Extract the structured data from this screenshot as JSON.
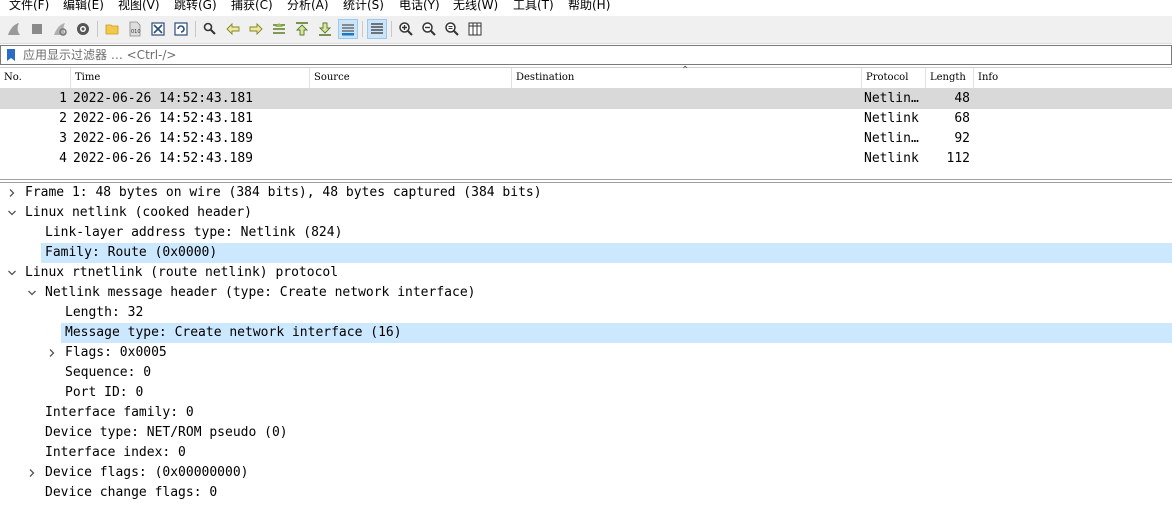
{
  "menu": [
    "文件(F)",
    "编辑(E)",
    "视图(V)",
    "跳转(G)",
    "捕获(C)",
    "分析(A)",
    "统计(S)",
    "电话(Y)",
    "无线(W)",
    "工具(T)",
    "帮助(H)"
  ],
  "toolbar": {
    "icons": [
      "shark-fin-start-icon",
      "stop-icon",
      "restart-icon",
      "options-gear-icon",
      "open-folder-icon",
      "save-file-icon",
      "close-file-icon",
      "reload-icon",
      "find-icon",
      "go-back-icon",
      "go-forward-icon",
      "go-to-packet-icon",
      "first-packet-icon",
      "last-packet-icon",
      "autoscroll-icon",
      "colorize-icon",
      "zoom-in-icon",
      "zoom-out-icon",
      "zoom-normal-icon",
      "resize-columns-icon"
    ]
  },
  "filter": {
    "placeholder": "应用显示过滤器 … <Ctrl-/>"
  },
  "packet_list": {
    "columns": [
      "No.",
      "Time",
      "Source",
      "Destination",
      "Protocol",
      "Length",
      "Info"
    ],
    "rows": [
      {
        "no": "1",
        "time": "2022-06-26 14:52:43.181",
        "source": "",
        "destination": "",
        "protocol": "Netlin…",
        "length": "48",
        "info": ""
      },
      {
        "no": "2",
        "time": "2022-06-26 14:52:43.181",
        "source": "",
        "destination": "",
        "protocol": "Netlink",
        "length": "68",
        "info": ""
      },
      {
        "no": "3",
        "time": "2022-06-26 14:52:43.189",
        "source": "",
        "destination": "",
        "protocol": "Netlin…",
        "length": "92",
        "info": ""
      },
      {
        "no": "4",
        "time": "2022-06-26 14:52:43.189",
        "source": "",
        "destination": "",
        "protocol": "Netlink",
        "length": "112",
        "info": ""
      }
    ],
    "selected_row": 0
  },
  "details": {
    "rows": [
      {
        "text": "Frame 1: 48 bytes on wire (384 bits), 48 bytes captured (384 bits)",
        "level": 0,
        "toggle": "collapsed",
        "highlight": false
      },
      {
        "text": "Linux netlink (cooked header)",
        "level": 0,
        "toggle": "expanded",
        "highlight": false
      },
      {
        "text": "Link-layer address type: Netlink (824)",
        "level": 1,
        "toggle": "none",
        "highlight": false
      },
      {
        "text": "Family: Route (0x0000)",
        "level": 1,
        "toggle": "none",
        "highlight": true
      },
      {
        "text": "Linux rtnetlink (route netlink) protocol",
        "level": 0,
        "toggle": "expanded",
        "highlight": false
      },
      {
        "text": "Netlink message header (type: Create network interface)",
        "level": 1,
        "toggle": "expanded",
        "highlight": false
      },
      {
        "text": "Length: 32",
        "level": 2,
        "toggle": "none",
        "highlight": false
      },
      {
        "text": "Message type: Create network interface (16)",
        "level": 2,
        "toggle": "none",
        "highlight": true
      },
      {
        "text": "Flags: 0x0005",
        "level": 2,
        "toggle": "collapsed",
        "highlight": false
      },
      {
        "text": "Sequence: 0",
        "level": 2,
        "toggle": "none",
        "highlight": false
      },
      {
        "text": "Port ID: 0",
        "level": 2,
        "toggle": "none",
        "highlight": false
      },
      {
        "text": "Interface family: 0",
        "level": 1,
        "toggle": "none",
        "highlight": false
      },
      {
        "text": "Device type: NET/ROM pseudo (0)",
        "level": 1,
        "toggle": "none",
        "highlight": false
      },
      {
        "text": "Interface index: 0",
        "level": 1,
        "toggle": "none",
        "highlight": false
      },
      {
        "text": "Device flags:  (0x00000000)",
        "level": 1,
        "toggle": "collapsed",
        "highlight": false
      },
      {
        "text": "Device change flags: 0",
        "level": 1,
        "toggle": "none",
        "highlight": false
      }
    ]
  },
  "colors": {
    "selected_packet_row": "#d9d9d9",
    "detail_highlight": "#cce8ff",
    "toolbar_bg": "#f0f0f0",
    "wireshark_blue": "#1679c4"
  }
}
